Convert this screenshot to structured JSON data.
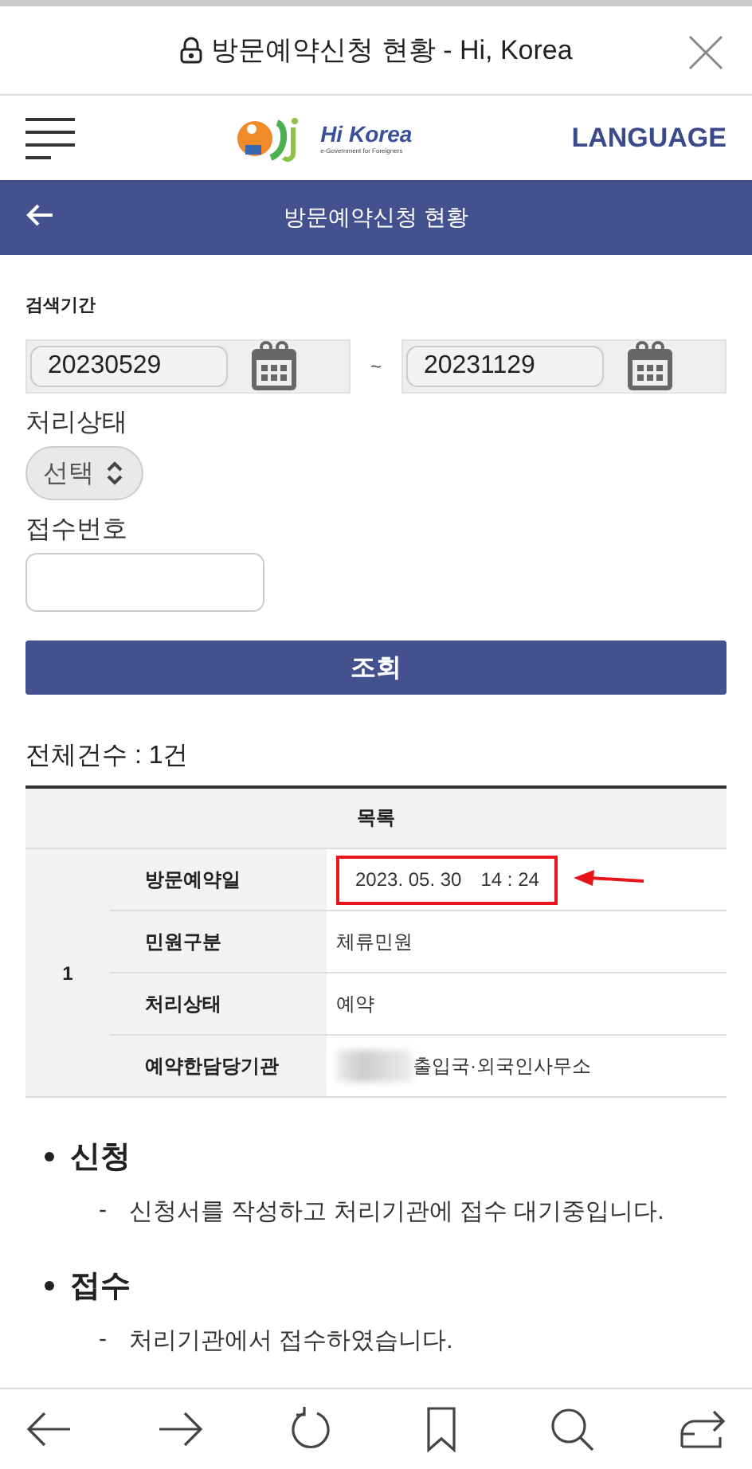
{
  "browser": {
    "title": "방문예약신청 현황 - Hi, Korea",
    "secure": true
  },
  "header": {
    "logo_text": "Hi Korea",
    "logo_subtitle": "e-Government for Foreigners",
    "language": "LANGUAGE"
  },
  "title_bar": {
    "title": "방문예약신청 현황"
  },
  "search": {
    "period_label": "검색기간",
    "date_from": "20230529",
    "separator": "~",
    "date_to": "20231129",
    "status_label": "처리상태",
    "status_value": "선택",
    "receipt_label": "접수번호",
    "button": "조회"
  },
  "total": "전체건수 : 1건",
  "table": {
    "header": "목록",
    "rows": [
      {
        "number": "1",
        "fields": [
          {
            "label": "방문예약일",
            "value": "2023. 05. 30　14 : 24",
            "highlighted": true,
            "redacted": false
          },
          {
            "label": "민원구분",
            "value": "체류민원",
            "highlighted": false,
            "redacted": false
          },
          {
            "label": "처리상태",
            "value": "예약",
            "highlighted": false,
            "redacted": false
          },
          {
            "label": "예약한담당기관",
            "value": "출입국·외국인사무소",
            "highlighted": false,
            "redacted": true
          }
        ]
      }
    ]
  },
  "legend": [
    {
      "term": "신청",
      "description": "신청서를 작성하고 처리기관에 접수 대기중입니다."
    },
    {
      "term": "접수",
      "description": "처리기관에서 접수하였습니다."
    }
  ],
  "dash": "-"
}
